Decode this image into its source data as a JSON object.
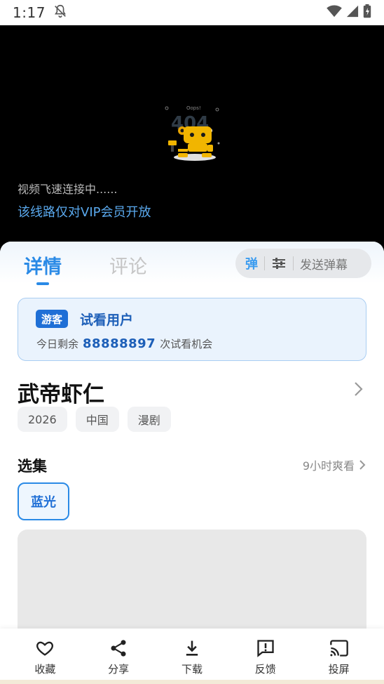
{
  "status_bar": {
    "time": "1:17"
  },
  "player": {
    "connecting_text": "视频飞速连接中......",
    "vip_text": "该线路仅对VIP会员开放",
    "error_art_code": "404",
    "error_art_caption": "Oops!"
  },
  "tabs": [
    {
      "label": "详情"
    },
    {
      "label": "评论"
    }
  ],
  "danmaku": {
    "toggle_label": "弹",
    "send_label": "发送弹幕"
  },
  "trial": {
    "badge": "游客",
    "title": "试看用户",
    "prefix": "今日剩余",
    "count": "88888897",
    "suffix": "次试看机会"
  },
  "drama": {
    "title": "武帝虾仁",
    "tags": [
      "2026",
      "中国",
      "漫剧"
    ]
  },
  "episodes": {
    "title": "选集",
    "update_text": "9小时爽看",
    "quality": "蓝光"
  },
  "actions": [
    {
      "label": "收藏",
      "icon": "heart-icon"
    },
    {
      "label": "分享",
      "icon": "share-icon"
    },
    {
      "label": "下载",
      "icon": "download-icon"
    },
    {
      "label": "反馈",
      "icon": "feedback-icon"
    },
    {
      "label": "投屏",
      "icon": "cast-icon"
    }
  ],
  "colors": {
    "accent": "#2a8ae6",
    "vip_text": "#5aa9ee",
    "badge_bg": "#1f6fd6",
    "player_bg": "#000000"
  }
}
